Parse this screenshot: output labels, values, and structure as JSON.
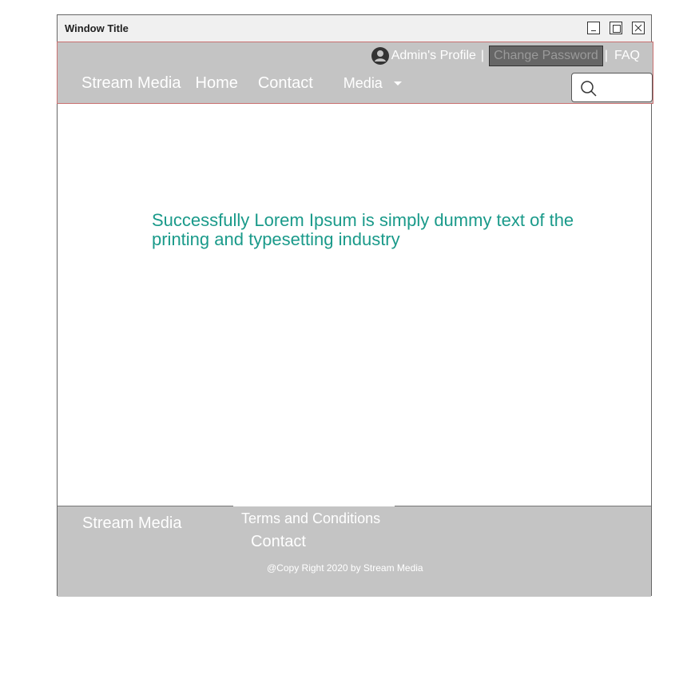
{
  "window": {
    "title": "Window Title"
  },
  "header": {
    "profile_label": "Admin's Profile",
    "separator": "|",
    "change_password_label": "Change Password",
    "faq_label": "FAQ"
  },
  "nav": {
    "brand": "Stream Media",
    "home": "Home",
    "contact": "Contact",
    "media": "Media"
  },
  "search": {
    "placeholder": ""
  },
  "main": {
    "message": "Successfully   Lorem Ipsum is simply dummy text of the printing and typesetting industry"
  },
  "footer": {
    "brand": "Stream Media",
    "terms": "Terms and Conditions",
    "contact": "Contact",
    "copyright": "@Copy Right 2020 by Stream Media"
  },
  "colors": {
    "nav_bg": "#c4c4c4",
    "message_text": "#1a9a8a",
    "nav_border": "#c97070"
  }
}
